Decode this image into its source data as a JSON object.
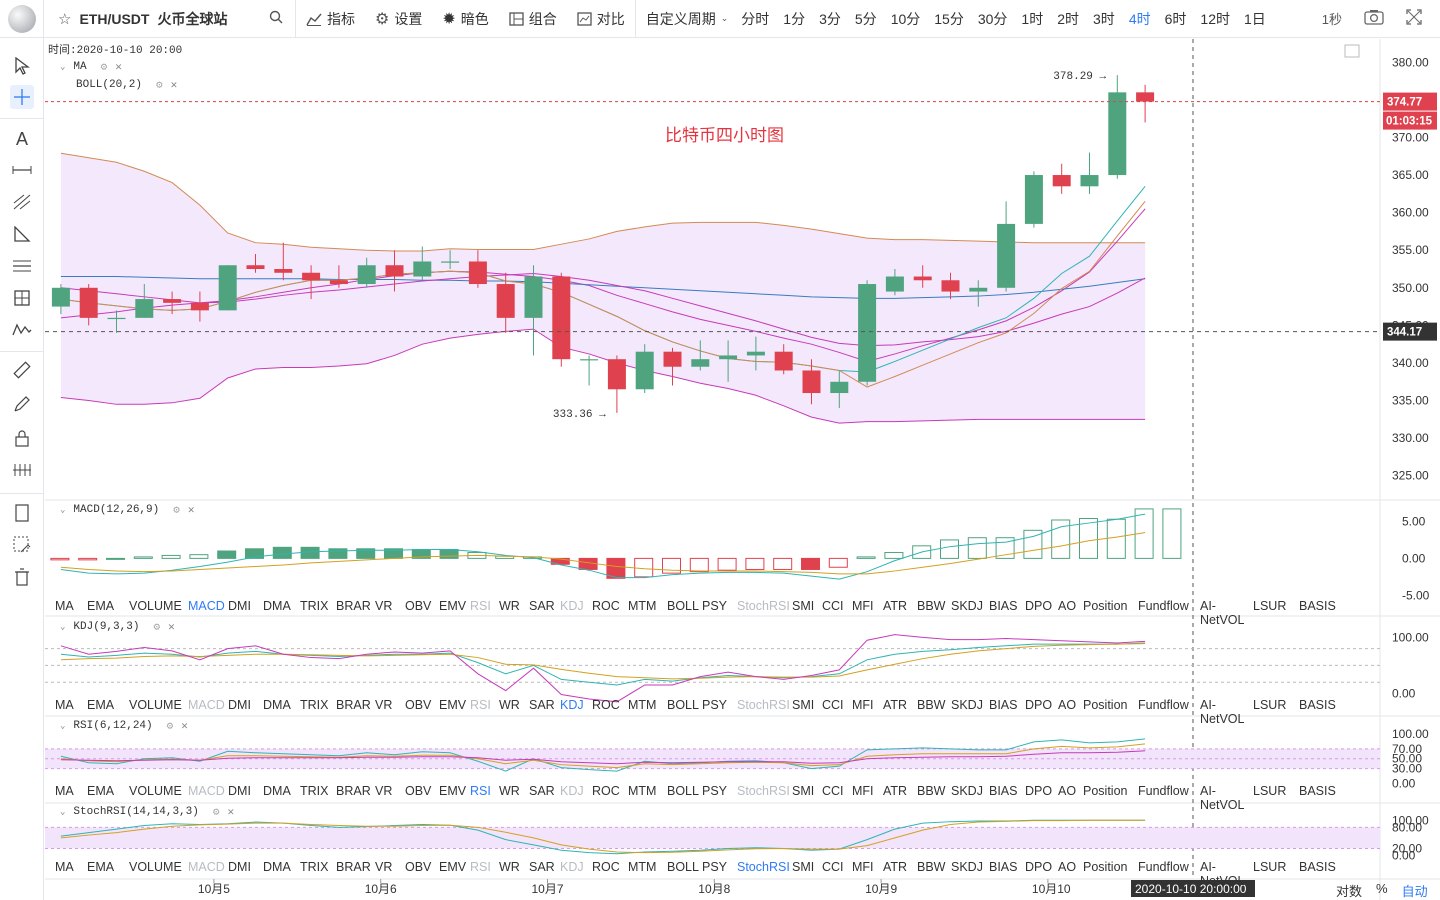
{
  "toolbar": {
    "symbol": "ETH/USDT",
    "exchange": "火币全球站",
    "buttons": [
      "指标",
      "设置",
      "暗色",
      "组合",
      "对比"
    ],
    "custom_period": "自定义周期",
    "periods": [
      "分时",
      "1分",
      "3分",
      "5分",
      "10分",
      "15分",
      "30分",
      "1时",
      "2时",
      "3时",
      "4时",
      "6时",
      "12时",
      "1日"
    ],
    "active_period": "4时",
    "right_label": "1秒",
    "accent": "#2e7bf6"
  },
  "main_pane": {
    "time_label": "时间:2020-10-10 20:00",
    "legend": [
      "MA",
      "BOLL(20,2)"
    ],
    "watermark": "比特币四小时图",
    "high_note": "378.29",
    "low_note": "333.36",
    "last_price": "374.77",
    "countdown": "01:03:15",
    "cross_price": "344.17"
  },
  "macd_pane": {
    "legend": "MACD(12,26,9)"
  },
  "kdj_pane": {
    "legend": "KDJ(9,3,3)"
  },
  "rsi_pane": {
    "legend": "RSI(6,12,24)"
  },
  "stochrsi_pane": {
    "legend": "StochRSI(14,14,3,3)"
  },
  "indicator_tabs": [
    "MA",
    "EMA",
    "VOLUME",
    "MACD",
    "DMI",
    "DMA",
    "TRIX",
    "BRAR",
    "VR",
    "OBV",
    "EMV",
    "RSI",
    "WR",
    "SAR",
    "KDJ",
    "ROC",
    "MTM",
    "BOLL",
    "PSY",
    "StochRSI",
    "SMI",
    "CCI",
    "MFI",
    "ATR",
    "BBW",
    "SKDJ",
    "BIAS",
    "DPO",
    "AO",
    "Position",
    "Fundflow",
    "AI-NetVOL",
    "LSUR",
    "BASIS"
  ],
  "tab_rows": [
    {
      "active": "MACD",
      "dim": [
        "RSI",
        "KDJ",
        "StochRSI"
      ]
    },
    {
      "active": "KDJ",
      "dim": [
        "MACD",
        "RSI",
        "StochRSI"
      ]
    },
    {
      "active": "RSI",
      "dim": [
        "MACD",
        "KDJ",
        "StochRSI"
      ]
    },
    {
      "active": "StochRSI",
      "dim": [
        "MACD",
        "RSI",
        "KDJ"
      ]
    }
  ],
  "bottom": {
    "cursor_time": "2020-10-10 20:00:00",
    "log_label": "对数",
    "pct_label": "%",
    "auto_label": "自动"
  },
  "chart_data": [
    {
      "type": "candlestick",
      "pair": "ETH/USDT",
      "interval": "4时",
      "x_ticks": [
        "10月5",
        "10月6",
        "10月7",
        "10月8",
        "10月9",
        "10月10"
      ],
      "y_ticks": [
        380.0,
        375.0,
        370.0,
        365.0,
        360.0,
        355.0,
        350.0,
        345.0,
        340.0,
        335.0,
        330.0,
        325.0
      ],
      "ylim": [
        323.5,
        381.5
      ],
      "candles": [
        {
          "o": 347.5,
          "h": 350.5,
          "l": 346.5,
          "c": 350.0
        },
        {
          "o": 350.0,
          "h": 350.5,
          "l": 345.0,
          "c": 346.0
        },
        {
          "o": 346.0,
          "h": 347.0,
          "l": 344.0,
          "c": 346.0
        },
        {
          "o": 346.0,
          "h": 350.5,
          "l": 346.0,
          "c": 348.5
        },
        {
          "o": 348.5,
          "h": 349.5,
          "l": 346.5,
          "c": 348.0
        },
        {
          "o": 348.0,
          "h": 349.5,
          "l": 345.5,
          "c": 347.0
        },
        {
          "o": 347.0,
          "h": 353.0,
          "l": 347.0,
          "c": 353.0
        },
        {
          "o": 353.0,
          "h": 354.5,
          "l": 352.0,
          "c": 352.5
        },
        {
          "o": 352.5,
          "h": 356.0,
          "l": 351.0,
          "c": 352.0
        },
        {
          "o": 352.0,
          "h": 353.0,
          "l": 348.5,
          "c": 351.0
        },
        {
          "o": 351.0,
          "h": 353.0,
          "l": 350.0,
          "c": 350.5
        },
        {
          "o": 350.5,
          "h": 354.0,
          "l": 350.0,
          "c": 353.0
        },
        {
          "o": 353.0,
          "h": 355.0,
          "l": 349.5,
          "c": 351.5
        },
        {
          "o": 351.5,
          "h": 355.5,
          "l": 351.0,
          "c": 353.5
        },
        {
          "o": 353.5,
          "h": 355.0,
          "l": 352.5,
          "c": 353.5
        },
        {
          "o": 353.5,
          "h": 355.0,
          "l": 350.0,
          "c": 350.5
        },
        {
          "o": 350.5,
          "h": 352.0,
          "l": 344.0,
          "c": 346.0
        },
        {
          "o": 346.0,
          "h": 353.0,
          "l": 341.0,
          "c": 351.5
        },
        {
          "o": 351.5,
          "h": 352.0,
          "l": 339.5,
          "c": 340.5
        },
        {
          "o": 340.5,
          "h": 341.0,
          "l": 337.0,
          "c": 340.5
        },
        {
          "o": 340.5,
          "h": 341.0,
          "l": 333.36,
          "c": 336.5
        },
        {
          "o": 336.5,
          "h": 342.5,
          "l": 336.0,
          "c": 341.5
        },
        {
          "o": 341.5,
          "h": 342.0,
          "l": 337.0,
          "c": 339.5
        },
        {
          "o": 339.5,
          "h": 343.0,
          "l": 339.0,
          "c": 340.5
        },
        {
          "o": 340.5,
          "h": 343.0,
          "l": 337.5,
          "c": 341.0
        },
        {
          "o": 341.0,
          "h": 343.5,
          "l": 339.0,
          "c": 341.5
        },
        {
          "o": 341.5,
          "h": 342.5,
          "l": 338.5,
          "c": 339.0
        },
        {
          "o": 339.0,
          "h": 340.5,
          "l": 334.5,
          "c": 336.0
        },
        {
          "o": 336.0,
          "h": 339.0,
          "l": 334.0,
          "c": 337.5
        },
        {
          "o": 337.5,
          "h": 351.0,
          "l": 337.0,
          "c": 350.5
        },
        {
          "o": 349.5,
          "h": 352.5,
          "l": 349.0,
          "c": 351.5
        },
        {
          "o": 351.5,
          "h": 353.0,
          "l": 350.0,
          "c": 351.0
        },
        {
          "o": 351.0,
          "h": 352.0,
          "l": 348.5,
          "c": 349.5
        },
        {
          "o": 349.5,
          "h": 351.0,
          "l": 347.5,
          "c": 350.0
        },
        {
          "o": 350.0,
          "h": 361.5,
          "l": 349.5,
          "c": 358.5
        },
        {
          "o": 358.5,
          "h": 365.5,
          "l": 358.0,
          "c": 365.0
        },
        {
          "o": 365.0,
          "h": 366.5,
          "l": 362.5,
          "c": 363.5
        },
        {
          "o": 363.5,
          "h": 368.0,
          "l": 362.5,
          "c": 365.0
        },
        {
          "o": 365.0,
          "h": 378.29,
          "l": 364.5,
          "c": 376.0
        },
        {
          "o": 376.0,
          "h": 377.0,
          "l": 372.0,
          "c": 374.77
        }
      ],
      "ma_fast": [
        348.5,
        348.0,
        347.6,
        347.2,
        347.0,
        347.2,
        348.2,
        349.4,
        350.3,
        351.0,
        351.0,
        351.3,
        351.8,
        352.0,
        352.2,
        352.0,
        350.9,
        350.5,
        349.4,
        347.8,
        346.2,
        344.3,
        342.8,
        341.6,
        340.6,
        340.2,
        340.1,
        339.6,
        339.0,
        338.8,
        340.2,
        341.7,
        343.2,
        344.7,
        346.0,
        348.6,
        351.9,
        354.2,
        358.9,
        363.5
      ],
      "ma_mid": [
        350.0,
        349.6,
        349.2,
        348.8,
        348.4,
        348.0,
        348.1,
        348.5,
        349.0,
        349.4,
        349.7,
        350.1,
        350.5,
        350.9,
        351.2,
        351.5,
        351.7,
        351.9,
        351.5,
        351.0,
        350.3,
        349.6,
        348.6,
        347.6,
        346.6,
        345.6,
        344.5,
        343.4,
        342.6,
        342.3,
        342.4,
        342.8,
        343.1,
        343.5,
        344.2,
        345.3,
        346.5,
        347.5,
        349.3,
        351.3
      ],
      "ma_slow": [
        351.5,
        351.5,
        351.5,
        351.4,
        351.3,
        351.2,
        351.2,
        351.2,
        351.2,
        351.2,
        351.1,
        351.1,
        351.1,
        351.0,
        351.0,
        350.9,
        350.9,
        350.8,
        350.6,
        350.4,
        350.2,
        350.0,
        349.8,
        349.6,
        349.4,
        349.2,
        349.0,
        348.8,
        348.7,
        348.6,
        348.6,
        348.7,
        348.8,
        348.9,
        349.1,
        349.4,
        349.8,
        350.2,
        350.7,
        351.2
      ],
      "boll_mid": [
        346.0,
        346.4,
        346.8,
        347.3,
        347.7,
        348.0,
        348.3,
        348.8,
        349.4,
        350.0,
        350.5,
        351.1,
        351.6,
        352.0,
        352.2,
        352.1,
        351.8,
        351.5,
        351.0,
        350.3,
        349.0,
        347.9,
        346.8,
        345.8,
        345.0,
        344.2,
        343.3,
        342.5,
        341.4,
        340.2,
        341.2,
        342.3,
        343.3,
        344.4,
        345.6,
        347.4,
        349.6,
        352.1,
        356.2,
        360.5
      ],
      "boll_up": [
        367.9,
        367.3,
        366.7,
        365.5,
        364.0,
        361.0,
        357.3,
        356.0,
        355.8,
        355.4,
        355.2,
        355.0,
        354.9,
        354.9,
        355.2,
        355.1,
        355.1,
        355.1,
        355.8,
        356.5,
        357.5,
        358.1,
        358.6,
        358.7,
        358.7,
        358.7,
        358.3,
        357.8,
        357.2,
        356.6,
        356.4,
        356.4,
        356.3,
        356.2,
        356.1,
        356.0,
        356.0,
        356.0,
        356.0,
        356.0
      ],
      "boll_dn": [
        335.4,
        335.0,
        334.5,
        334.5,
        334.7,
        335.3,
        338.0,
        339.2,
        339.4,
        339.4,
        339.6,
        339.9,
        341.0,
        342.5,
        343.3,
        343.8,
        344.2,
        344.5,
        342.1,
        341.2,
        340.0,
        339.0,
        338.2,
        337.3,
        336.6,
        335.7,
        334.3,
        332.8,
        332.0,
        332.2,
        332.2,
        332.3,
        332.4,
        332.5,
        332.5,
        332.5,
        332.5,
        332.5,
        332.5,
        332.5
      ]
    },
    {
      "type": "bar",
      "name": "MACD(12,26,9)",
      "y_ticks": [
        5.0,
        0.0,
        -5.0
      ],
      "ylim": [
        -5.5,
        7.5
      ],
      "hist": [
        -0.2,
        -0.2,
        0.0,
        0.2,
        0.4,
        0.5,
        1.0,
        1.3,
        1.5,
        1.5,
        1.3,
        1.3,
        1.3,
        1.2,
        1.2,
        0.8,
        0.3,
        0.2,
        -0.8,
        -1.5,
        -2.7,
        -2.5,
        -2.0,
        -1.8,
        -1.6,
        -1.5,
        -1.5,
        -1.5,
        -1.2,
        0.2,
        0.8,
        1.7,
        2.5,
        2.8,
        2.8,
        3.8,
        5.2,
        5.4,
        5.3,
        6.7,
        6.7
      ],
      "dif": [
        -1.5,
        -2.0,
        -2.1,
        -2.0,
        -1.6,
        -1.1,
        -0.5,
        0.2,
        0.6,
        0.9,
        1.0,
        1.1,
        1.1,
        1.2,
        1.2,
        0.9,
        0.4,
        0.1,
        -0.9,
        -1.6,
        -2.6,
        -2.6,
        -2.2,
        -2.0,
        -1.9,
        -1.9,
        -2.0,
        -2.4,
        -2.8,
        -1.8,
        -0.3,
        0.9,
        1.6,
        2.0,
        2.2,
        3.0,
        4.3,
        4.8,
        5.3,
        6.0,
        6.5
      ],
      "dea": [
        -1.2,
        -1.5,
        -1.7,
        -1.8,
        -1.7,
        -1.5,
        -1.3,
        -1.1,
        -0.9,
        -0.6,
        -0.4,
        -0.2,
        0.0,
        0.2,
        0.3,
        0.4,
        0.3,
        0.2,
        -0.1,
        -0.6,
        -1.1,
        -1.4,
        -1.6,
        -1.7,
        -1.7,
        -1.7,
        -1.8,
        -1.9,
        -2.1,
        -2.1,
        -1.7,
        -1.2,
        -0.7,
        -0.1,
        0.5,
        1.1,
        1.7,
        2.4,
        2.9,
        3.5,
        4.1
      ]
    },
    {
      "type": "line",
      "name": "KDJ(9,3,3)",
      "y_ticks": [
        100.0,
        0.0
      ],
      "ylim": [
        -10,
        115
      ],
      "k": [
        70,
        65,
        68,
        72,
        70,
        65,
        72,
        75,
        70,
        68,
        66,
        68,
        70,
        70,
        72,
        55,
        35,
        50,
        25,
        20,
        15,
        25,
        22,
        28,
        32,
        30,
        28,
        30,
        35,
        60,
        70,
        75,
        78,
        82,
        85,
        88,
        88,
        88,
        88,
        90,
        90
      ],
      "d": [
        60,
        62,
        63,
        66,
        67,
        66,
        68,
        70,
        70,
        69,
        68,
        67,
        68,
        69,
        70,
        64,
        52,
        51,
        43,
        36,
        30,
        28,
        26,
        27,
        29,
        30,
        29,
        29,
        31,
        42,
        52,
        62,
        70,
        76,
        80,
        84,
        86,
        87,
        88,
        89,
        90
      ],
      "j": [
        85,
        70,
        75,
        82,
        76,
        60,
        80,
        85,
        70,
        64,
        62,
        70,
        74,
        72,
        76,
        35,
        5,
        45,
        -2,
        -10,
        -15,
        15,
        15,
        30,
        38,
        30,
        25,
        32,
        42,
        95,
        105,
        100,
        96,
        96,
        98,
        96,
        94,
        92,
        90,
        93,
        91
      ]
    },
    {
      "type": "line",
      "name": "RSI(6,12,24)",
      "y_ticks": [
        100.0,
        70.0,
        50.0,
        30.0,
        0.0
      ],
      "ylim": [
        -5,
        110
      ],
      "rsi1": [
        55,
        42,
        40,
        50,
        52,
        45,
        65,
        62,
        60,
        58,
        56,
        62,
        58,
        64,
        62,
        45,
        25,
        50,
        32,
        28,
        25,
        45,
        40,
        42,
        45,
        46,
        42,
        30,
        35,
        68,
        70,
        72,
        70,
        68,
        68,
        84,
        88,
        82,
        84,
        90,
        86
      ],
      "rsi2": [
        50,
        46,
        44,
        48,
        49,
        47,
        56,
        56,
        55,
        54,
        53,
        56,
        55,
        57,
        57,
        50,
        40,
        47,
        38,
        35,
        32,
        40,
        38,
        40,
        42,
        43,
        42,
        36,
        38,
        55,
        58,
        60,
        60,
        60,
        60,
        70,
        75,
        72,
        74,
        80,
        78
      ],
      "rsi3": [
        48,
        47,
        46,
        47,
        48,
        47,
        51,
        52,
        52,
        52,
        52,
        53,
        53,
        54,
        54,
        52,
        47,
        49,
        44,
        42,
        40,
        43,
        42,
        43,
        44,
        44,
        44,
        41,
        42,
        50,
        52,
        53,
        54,
        54,
        55,
        59,
        62,
        62,
        63,
        66,
        66
      ]
    },
    {
      "type": "line",
      "name": "StochRSI(14,14,3,3)",
      "y_ticks": [
        100.0,
        80.0,
        20.0,
        0.0
      ],
      "ylim": [
        -10,
        115
      ],
      "k": [
        55,
        65,
        75,
        85,
        90,
        88,
        90,
        95,
        92,
        85,
        80,
        82,
        85,
        88,
        86,
        72,
        45,
        30,
        15,
        8,
        5,
        10,
        12,
        15,
        20,
        22,
        20,
        15,
        18,
        45,
        75,
        92,
        96,
        98,
        98,
        100,
        100,
        100,
        100,
        100,
        100
      ],
      "d": [
        50,
        58,
        65,
        75,
        83,
        87,
        89,
        92,
        92,
        88,
        85,
        83,
        83,
        85,
        86,
        80,
        66,
        50,
        30,
        18,
        10,
        8,
        9,
        12,
        16,
        19,
        20,
        18,
        18,
        28,
        50,
        72,
        88,
        95,
        97,
        99,
        99,
        100,
        100,
        100,
        100
      ]
    }
  ]
}
